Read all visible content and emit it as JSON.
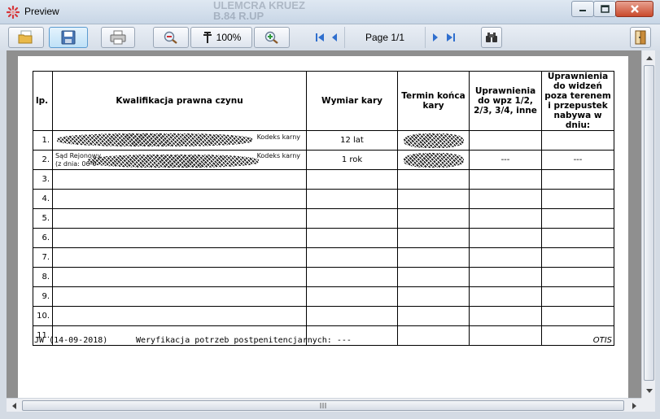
{
  "window": {
    "title": "Preview",
    "ghost_title": "ULEMCRA KRUEZ\nB.84 R.UP"
  },
  "toolbar": {
    "zoom_label": "100%",
    "page_label": "Page 1/1"
  },
  "report": {
    "headers": [
      "lp.",
      "Kwalifikacja prawna czynu",
      "Wymiar kary",
      "Termin końca kary",
      "Uprawnienia do wpz 1/2, 2/3, 3/4, inne",
      "Uprawnienia do widzeń poza terenem i przepustek nabywa w dniu:"
    ],
    "rows": [
      {
        "lp": "1.",
        "qual_suffix": "Kodeks karny",
        "qual_prefix": "",
        "qual_sub": "",
        "wymiar": "12 lat",
        "termin": "",
        "upr1": "",
        "upr2": ""
      },
      {
        "lp": "2.",
        "qual_suffix": "Kodeks karny",
        "qual_prefix": "Sąd Rejonowy",
        "qual_sub": "(z dnia: 06-0",
        "wymiar": "1 rok",
        "termin": "",
        "upr1": "---",
        "upr2": "---"
      },
      {
        "lp": "3.",
        "wymiar": "",
        "termin": "",
        "upr1": "",
        "upr2": ""
      },
      {
        "lp": "4.",
        "wymiar": "",
        "termin": "",
        "upr1": "",
        "upr2": ""
      },
      {
        "lp": "5.",
        "wymiar": "",
        "termin": "",
        "upr1": "",
        "upr2": ""
      },
      {
        "lp": "6.",
        "wymiar": "",
        "termin": "",
        "upr1": "",
        "upr2": ""
      },
      {
        "lp": "7.",
        "wymiar": "",
        "termin": "",
        "upr1": "",
        "upr2": ""
      },
      {
        "lp": "8.",
        "wymiar": "",
        "termin": "",
        "upr1": "",
        "upr2": ""
      },
      {
        "lp": "9.",
        "wymiar": "",
        "termin": "",
        "upr1": "",
        "upr2": ""
      },
      {
        "lp": "10.",
        "wymiar": "",
        "termin": "",
        "upr1": "",
        "upr2": ""
      },
      {
        "lp": "11.",
        "wymiar": "",
        "termin": "",
        "upr1": "",
        "upr2": ""
      }
    ],
    "footer": {
      "left": "JW (14-09-2018)",
      "middle": "Weryfikacja potrzeb postpenitencjarnych: ---",
      "right": "OTIS"
    }
  },
  "icons": {
    "app": "preview-app-icon",
    "open": "open-folder-icon",
    "save": "save-disk-icon",
    "print": "printer-icon",
    "zoom_out": "zoom-out-icon",
    "zoom_in": "zoom-in-icon",
    "zoom_tool": "zoom-crosshair-icon",
    "first": "first-page-icon",
    "prev": "previous-page-icon",
    "next": "next-page-icon",
    "last": "last-page-icon",
    "binoculars": "binoculars-icon",
    "exit": "exit-door-icon"
  },
  "colors": {
    "nav_arrow": "#2f6fce",
    "close_button": "#c94a2c",
    "preview_background": "#8f8f8f"
  }
}
